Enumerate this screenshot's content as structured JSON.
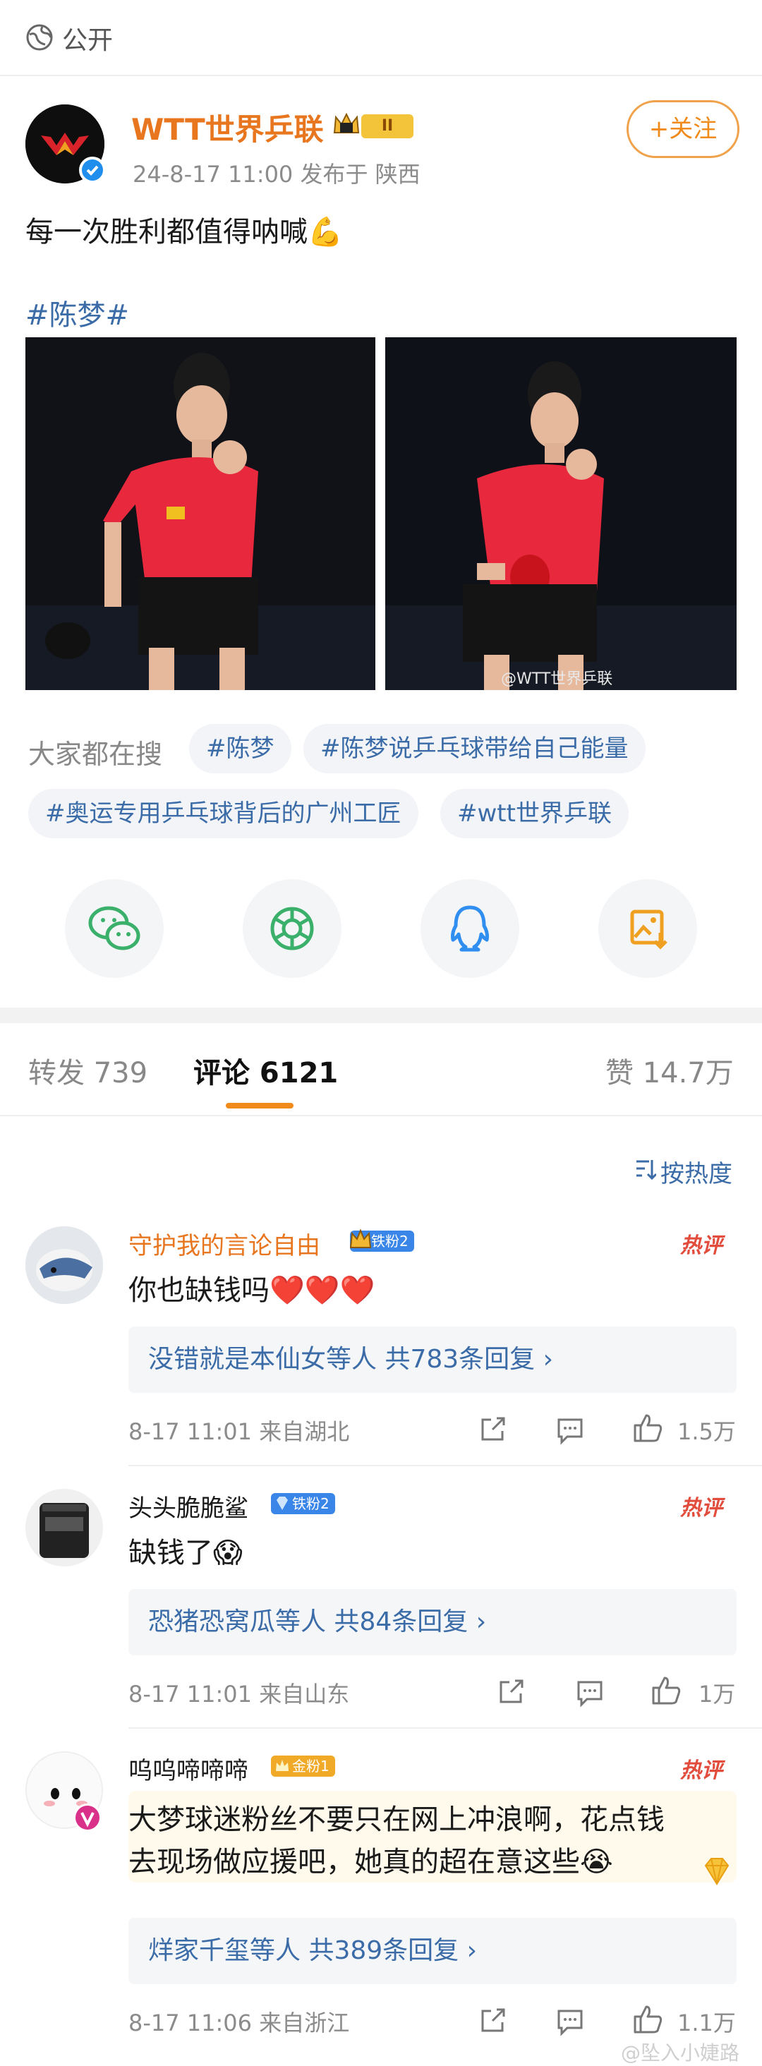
{
  "topbar": {
    "visibility": "公开",
    "icon": "globe-icon"
  },
  "post": {
    "author": "WTT世界乒联",
    "level_badge": "II",
    "meta": "24-8-17 11:00  发布于 陕西",
    "follow_label": "+关注",
    "text": "每一次胜利都值得呐喊💪",
    "hashtag": "#陈梦#",
    "watermark": "@WTT世界乒联"
  },
  "search": {
    "label": "大家都在搜",
    "chips": [
      "#陈梦",
      "#陈梦说乒乓球带给自己能量",
      "#奥运专用乒乓球背后的广州工匠",
      "#wtt世界乒联"
    ]
  },
  "share_icons": [
    "wechat-icon",
    "moments-icon",
    "qq-icon",
    "save-image-icon"
  ],
  "tabs": {
    "repost": "转发 739",
    "comments": "评论 6121",
    "likes": "赞 14.7万"
  },
  "sort_label": "按热度",
  "comments": [
    {
      "name": "守护我的言论自由",
      "badge": "铁粉2",
      "hot": "热评",
      "text": "你也缺钱吗❤️❤️❤️",
      "reply": "没错就是本仙女等人  共783条回复 ›",
      "meta": "8-17 11:01  来自湖北",
      "likes": "1.5万"
    },
    {
      "name": "头头脆脆鲨",
      "badge": "铁粉2",
      "hot": "热评",
      "text": "缺钱了😱",
      "reply": "恐猪恐窝瓜等人  共84条回复 ›",
      "meta": "8-17 11:01  来自山东",
      "likes": "1万"
    },
    {
      "name": "呜呜啼啼啼",
      "badge": "金粉1",
      "hot": "热评",
      "text_line1": "大梦球迷粉丝不要只在网上冲浪啊，花点钱",
      "text_line2": "去现场做应援吧，她真的超在意这些😭",
      "reply": "烊家千玺等人  共389条回复 ›",
      "meta": "8-17 11:06  来自浙江",
      "likes": "1.1万"
    }
  ],
  "bottom_watermark": "@坠入小婕路",
  "colors": {
    "accent": "#f08a1a",
    "link": "#3b6ca8",
    "hot": "#e24c3c",
    "author": "#e8761f"
  }
}
